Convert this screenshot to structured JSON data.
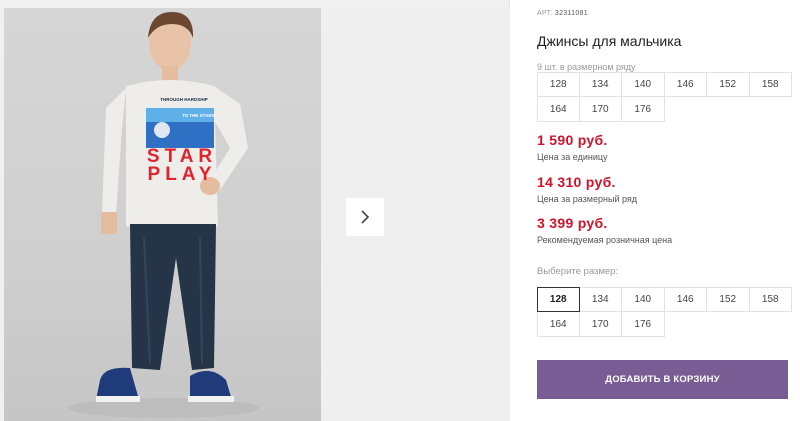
{
  "product": {
    "article_label": "АРТ.",
    "article_value": "32311081",
    "title": "Джинсы для мальчика",
    "row_note": "9 шт. в размерном ряду",
    "size_row": [
      "128",
      "134",
      "140",
      "146",
      "152",
      "158",
      "164",
      "170",
      "176"
    ]
  },
  "prices": [
    {
      "amount": "1 590 руб.",
      "label": "Цена за единицу"
    },
    {
      "amount": "14 310 руб.",
      "label": "Цена за размерный ряд"
    },
    {
      "amount": "3 399 руб.",
      "label": "Рекомендуемая розничная цена"
    }
  ],
  "size_picker": {
    "label": "Выберите размер:",
    "options": [
      "128",
      "134",
      "140",
      "146",
      "152",
      "158",
      "164",
      "170",
      "176"
    ],
    "selected": "128"
  },
  "cart_button": "ДОБАВИТЬ В КОРЗИНУ",
  "gallery": {
    "next_icon": "chevron-right-icon",
    "shirt_print_lines": [
      "THROUGH HARDSHIP",
      "TO THE STARS"
    ],
    "shirt_big_text": [
      "STAR",
      "PLAY"
    ]
  },
  "colors": {
    "price": "#d4102a",
    "button": "#7a5c95"
  }
}
